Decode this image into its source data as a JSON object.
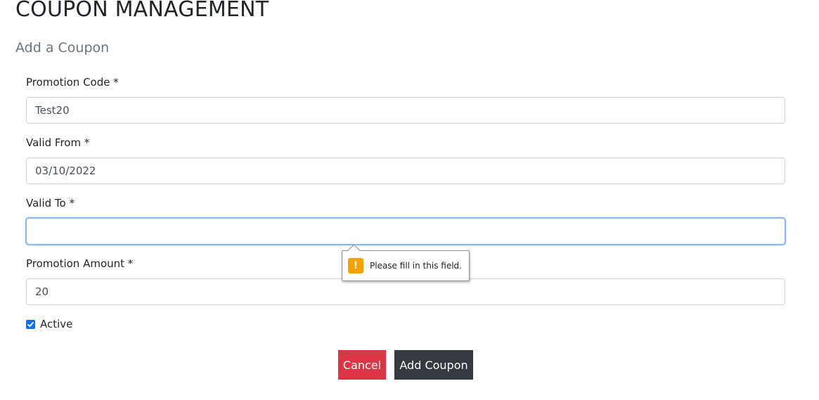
{
  "page": {
    "title": "COUPON MANAGEMENT",
    "section_title": "Add a Coupon"
  },
  "form": {
    "promotion_code": {
      "label": "Promotion Code *",
      "value": "Test20"
    },
    "valid_from": {
      "label": "Valid From *",
      "value": "03/10/2022"
    },
    "valid_to": {
      "label": "Valid To *",
      "value": ""
    },
    "promotion_amount": {
      "label": "Promotion Amount *",
      "value": "20"
    },
    "active": {
      "label": "Active",
      "checked": true
    }
  },
  "validation_tooltip": {
    "icon": "warning-icon",
    "message": "Please fill in this field."
  },
  "buttons": {
    "cancel_label": "Cancel",
    "add_label": "Add Coupon"
  },
  "colors": {
    "cancel": "#dc3545",
    "add": "#343a40",
    "checkbox": "#0d6efd",
    "warning": "#f5a200"
  }
}
